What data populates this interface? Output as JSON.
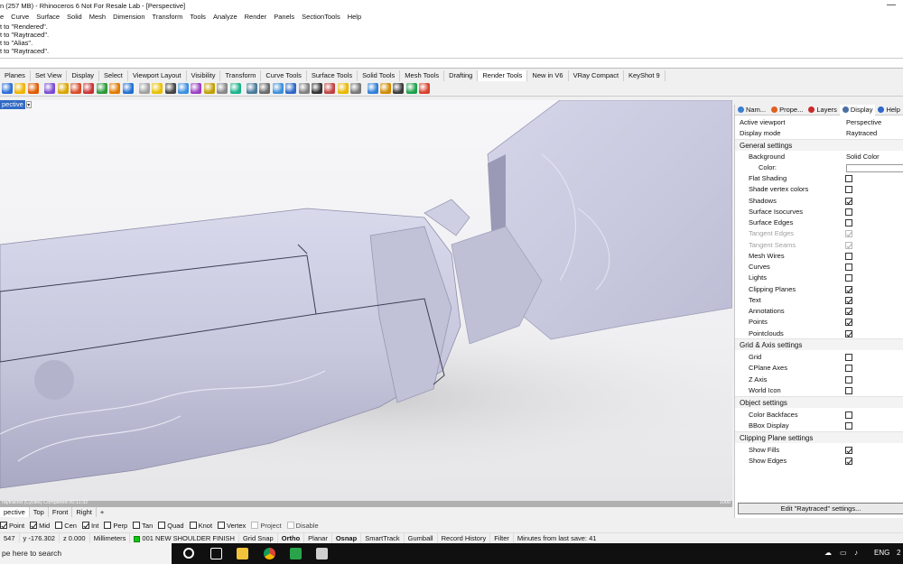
{
  "window": {
    "title": "n (257 MB) - Rhinoceros 6 Not For Resale Lab - [Perspective]",
    "minimize_glyph": "—"
  },
  "menu": [
    "e",
    "Curve",
    "Surface",
    "Solid",
    "Mesh",
    "Dimension",
    "Transform",
    "Tools",
    "Analyze",
    "Render",
    "Panels",
    "SectionTools",
    "Help"
  ],
  "command_history": [
    "t to \"Rendered\".",
    "t to \"Raytraced\".",
    "t to \"Alias\".",
    "t to \"Raytraced\"."
  ],
  "toolbar_tabs": [
    "Planes",
    "Set View",
    "Display",
    "Select",
    "Viewport Layout",
    "Visibility",
    "Transform",
    "Curve Tools",
    "Surface Tools",
    "Solid Tools",
    "Mesh Tools",
    "Drafting",
    "Render Tools",
    "New in V6",
    "VRay Compact",
    "KeyShot 9"
  ],
  "active_toolbar_tab": "Render Tools",
  "toolbar_icon_colors": [
    "#2b6fd6",
    "#f0b400",
    "#e05a00",
    "#7a4bd1",
    "#d9a400",
    "#d84b2a",
    "#c83232",
    "#2c9a3a",
    "#e07a00",
    "#1f6fd1",
    "#a0a0a0",
    "#e8c000",
    "#444444",
    "#3b8fe0",
    "#9b3fc2",
    "#c0a000",
    "#888888",
    "#1bb28a",
    "#4a7a9a",
    "#6a6a6a",
    "#3e8fda",
    "#2f66c8",
    "#808080",
    "#333333",
    "#c04040",
    "#e8b800",
    "#777777",
    "#2f7fd6",
    "#d08a00",
    "#3a3a3a",
    "#1ea04a",
    "#d8402a"
  ],
  "viewport": {
    "label": "pective",
    "dropdown_glyph": "▾",
    "render_status": "raytraced (Cycles)  Completed  00:11:32",
    "render_progress": "1000",
    "tabs": [
      "pective",
      "Top",
      "Front",
      "Right"
    ],
    "add_tab_glyph": "+"
  },
  "osnap": [
    {
      "label": "Point",
      "checked": true
    },
    {
      "label": "Mid",
      "checked": true
    },
    {
      "label": "Cen",
      "checked": false
    },
    {
      "label": "Int",
      "checked": true
    },
    {
      "label": "Perp",
      "checked": false
    },
    {
      "label": "Tan",
      "checked": false
    },
    {
      "label": "Quad",
      "checked": false
    },
    {
      "label": "Knot",
      "checked": false
    },
    {
      "label": "Vertex",
      "checked": false
    },
    {
      "label": "Project",
      "checked": false,
      "dim": true
    },
    {
      "label": "Disable",
      "checked": false,
      "dim": true
    }
  ],
  "status": {
    "x": "547",
    "y": "y -176.302",
    "z": "z 0.000",
    "units": "Millimeters",
    "layer": "001 NEW SHOULDER FINISH",
    "layer_color": "#12c712",
    "grid_snap": "Grid Snap",
    "ortho": "Ortho",
    "planar": "Planar",
    "osnap": "Osnap",
    "smarttrack": "SmartTrack",
    "gumball": "Gumball",
    "record_history": "Record History",
    "filter": "Filter",
    "save_info": "Minutes from last save: 41"
  },
  "taskbar": {
    "search_placeholder": "pe here to search",
    "lang": "ENG",
    "time_partial": "2"
  },
  "panel": {
    "tabs": [
      {
        "label": "Nam...",
        "icon_color": "#3b7fd0"
      },
      {
        "label": "Prope...",
        "icon_color": "#e0601c"
      },
      {
        "label": "Layers",
        "icon_color": "#c82a2a"
      },
      {
        "label": "Display",
        "icon_color": "#4a6fa5"
      },
      {
        "label": "Help",
        "icon_color": "#2f66c8"
      }
    ],
    "active_viewport_label": "Active viewport",
    "active_viewport_value": "Perspective",
    "display_mode_label": "Display mode",
    "display_mode_value": "Raytraced",
    "general_title": "General settings",
    "background_label": "Background",
    "background_value": "Solid Color",
    "color_label": "Color:",
    "general_options": [
      {
        "label": "Flat Shading",
        "checked": false
      },
      {
        "label": "Shade vertex colors",
        "checked": false
      },
      {
        "label": "Shadows",
        "checked": true
      },
      {
        "label": "Surface Isocurves",
        "checked": false
      },
      {
        "label": "Surface Edges",
        "checked": false
      },
      {
        "label": "Tangent Edges",
        "checked": true,
        "disabled": true
      },
      {
        "label": "Tangent Seams",
        "checked": true,
        "disabled": true
      },
      {
        "label": "Mesh Wires",
        "checked": false
      },
      {
        "label": "Curves",
        "checked": false
      },
      {
        "label": "Lights",
        "checked": false
      },
      {
        "label": "Clipping Planes",
        "checked": true
      },
      {
        "label": "Text",
        "checked": true
      },
      {
        "label": "Annotations",
        "checked": true
      },
      {
        "label": "Points",
        "checked": true
      },
      {
        "label": "Pointclouds",
        "checked": true
      }
    ],
    "grid_title": "Grid & Axis settings",
    "grid_options": [
      {
        "label": "Grid",
        "checked": false
      },
      {
        "label": "CPlane Axes",
        "checked": false
      },
      {
        "label": "Z Axis",
        "checked": false
      },
      {
        "label": "World Icon",
        "checked": false
      }
    ],
    "object_title": "Object settings",
    "object_options": [
      {
        "label": "Color Backfaces",
        "checked": false
      },
      {
        "label": "BBox Display",
        "checked": false
      }
    ],
    "clip_title": "Clipping Plane settings",
    "clip_options": [
      {
        "label": "Show Fills",
        "checked": true
      },
      {
        "label": "Show Edges",
        "checked": true
      }
    ],
    "edit_button": "Edit \"Raytraced\" settings..."
  }
}
